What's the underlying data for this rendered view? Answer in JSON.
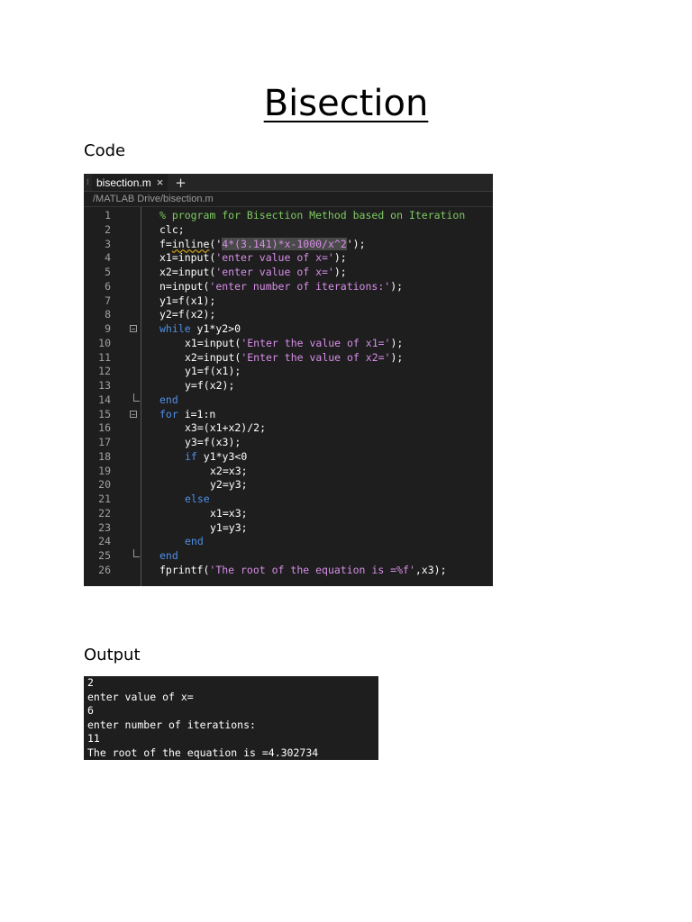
{
  "title": "Bisection",
  "code_label": "Code",
  "output_label": "Output",
  "editor": {
    "tab_name": "bisection.m",
    "tab_close": "×",
    "tab_add": "+",
    "path": "/MATLAB Drive/bisection.m",
    "lines": [
      {
        "n": "1",
        "indent": 0,
        "parts": [
          {
            "t": "% program for Bisection Method based on Iteration",
            "c": "cm"
          }
        ]
      },
      {
        "n": "2",
        "indent": 0,
        "parts": [
          {
            "t": "clc;",
            "c": ""
          }
        ]
      },
      {
        "n": "3",
        "indent": 0,
        "parts": [
          {
            "t": "f=",
            "c": ""
          },
          {
            "t": "inline",
            "c": "wavy"
          },
          {
            "t": "('",
            "c": ""
          },
          {
            "t": "4*(3.141)*x-1000/x^2",
            "c": "str hl"
          },
          {
            "t": "');",
            "c": ""
          }
        ]
      },
      {
        "n": "4",
        "indent": 0,
        "parts": [
          {
            "t": "x1=input(",
            "c": ""
          },
          {
            "t": "'enter value of x='",
            "c": "str"
          },
          {
            "t": ");",
            "c": ""
          }
        ]
      },
      {
        "n": "5",
        "indent": 0,
        "parts": [
          {
            "t": "x2=input(",
            "c": ""
          },
          {
            "t": "'enter value of x='",
            "c": "str"
          },
          {
            "t": ");",
            "c": ""
          }
        ]
      },
      {
        "n": "6",
        "indent": 0,
        "parts": [
          {
            "t": "n=input(",
            "c": ""
          },
          {
            "t": "'enter number of iterations:'",
            "c": "str"
          },
          {
            "t": ");",
            "c": ""
          }
        ]
      },
      {
        "n": "7",
        "indent": 0,
        "parts": [
          {
            "t": "y1=f(x1);",
            "c": ""
          }
        ]
      },
      {
        "n": "8",
        "indent": 0,
        "parts": [
          {
            "t": "y2=f(x2);",
            "c": ""
          }
        ]
      },
      {
        "n": "9",
        "indent": 0,
        "fold": "open",
        "parts": [
          {
            "t": "while",
            "c": "kw"
          },
          {
            "t": " y1*y2>0",
            "c": ""
          }
        ]
      },
      {
        "n": "10",
        "indent": 1,
        "parts": [
          {
            "t": "x1=input(",
            "c": ""
          },
          {
            "t": "'Enter the value of x1='",
            "c": "str"
          },
          {
            "t": ");",
            "c": ""
          }
        ]
      },
      {
        "n": "11",
        "indent": 1,
        "parts": [
          {
            "t": "x2=input(",
            "c": ""
          },
          {
            "t": "'Enter the value of x2='",
            "c": "str"
          },
          {
            "t": ");",
            "c": ""
          }
        ]
      },
      {
        "n": "12",
        "indent": 1,
        "parts": [
          {
            "t": "y1=f(x1);",
            "c": ""
          }
        ]
      },
      {
        "n": "13",
        "indent": 1,
        "parts": [
          {
            "t": "y=f(x2);",
            "c": ""
          }
        ]
      },
      {
        "n": "14",
        "indent": 0,
        "fold": "end",
        "parts": [
          {
            "t": "end",
            "c": "kw"
          }
        ]
      },
      {
        "n": "15",
        "indent": 0,
        "fold": "open",
        "parts": [
          {
            "t": "for",
            "c": "kw"
          },
          {
            "t": " i=1:n",
            "c": ""
          }
        ]
      },
      {
        "n": "16",
        "indent": 1,
        "parts": [
          {
            "t": "x3=(x1+x2)/2;",
            "c": ""
          }
        ]
      },
      {
        "n": "17",
        "indent": 1,
        "parts": [
          {
            "t": "y3=f(x3);",
            "c": ""
          }
        ]
      },
      {
        "n": "18",
        "indent": 1,
        "parts": [
          {
            "t": "if",
            "c": "kw"
          },
          {
            "t": " y1*y3<0",
            "c": ""
          }
        ]
      },
      {
        "n": "19",
        "indent": 2,
        "parts": [
          {
            "t": "x2=x3;",
            "c": ""
          }
        ]
      },
      {
        "n": "20",
        "indent": 2,
        "parts": [
          {
            "t": "y2=y3;",
            "c": ""
          }
        ]
      },
      {
        "n": "21",
        "indent": 1,
        "parts": [
          {
            "t": "else",
            "c": "kw"
          }
        ]
      },
      {
        "n": "22",
        "indent": 2,
        "parts": [
          {
            "t": "x1=x3;",
            "c": ""
          }
        ]
      },
      {
        "n": "23",
        "indent": 2,
        "parts": [
          {
            "t": "y1=y3;",
            "c": ""
          }
        ]
      },
      {
        "n": "24",
        "indent": 1,
        "parts": [
          {
            "t": "end",
            "c": "kw"
          }
        ]
      },
      {
        "n": "25",
        "indent": 0,
        "fold": "end",
        "parts": [
          {
            "t": "end",
            "c": "kw"
          }
        ]
      },
      {
        "n": "26",
        "indent": 0,
        "parts": [
          {
            "t": "fprintf(",
            "c": ""
          },
          {
            "t": "'The root of the equation is =%f'",
            "c": "str"
          },
          {
            "t": ",x3);",
            "c": ""
          }
        ]
      }
    ]
  },
  "console": {
    "lines": [
      "2",
      "enter value of x=",
      "6",
      "enter number of iterations:",
      "11",
      "The root of the equation is =4.302734"
    ]
  }
}
